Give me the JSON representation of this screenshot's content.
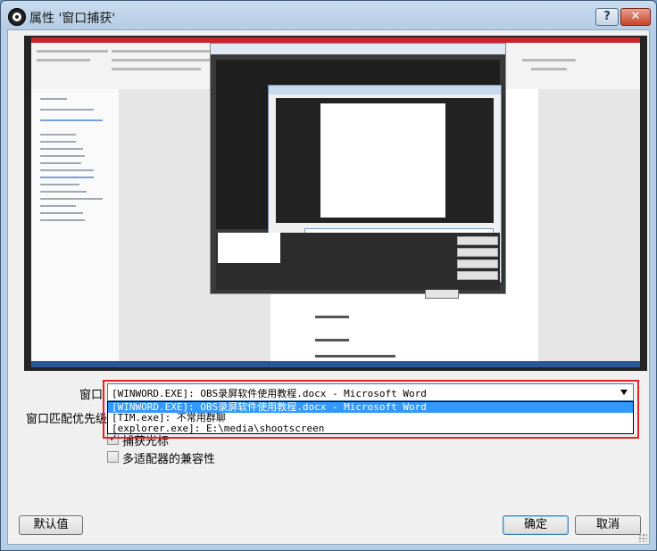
{
  "window": {
    "title": "属性 '窗口捕获'",
    "help_label": "?",
    "close_label": "✕"
  },
  "form": {
    "window_label": "窗口",
    "priority_label": "窗口匹配优先级",
    "window_select": {
      "value": "[WINWORD.EXE]: OBS录屏软件使用教程.docx - Microsoft Word",
      "options": [
        "[WINWORD.EXE]: OBS录屏软件使用教程.docx - Microsoft Word",
        "[TIM.exe]: 不常用群聊",
        "[explorer.exe]: E:\\media\\shootscreen"
      ],
      "selected_index": 0
    },
    "capture_cursor": {
      "label": "捕获光标",
      "checked": true
    },
    "multi_adapter": {
      "label": "多适配器的兼容性",
      "checked": false
    }
  },
  "buttons": {
    "defaults": "默认值",
    "ok": "确定",
    "cancel": "取消"
  },
  "colors": {
    "highlight_border": "#e0242a",
    "selection": "#3399ff",
    "word_ribbon_accent": "#c8242b"
  }
}
